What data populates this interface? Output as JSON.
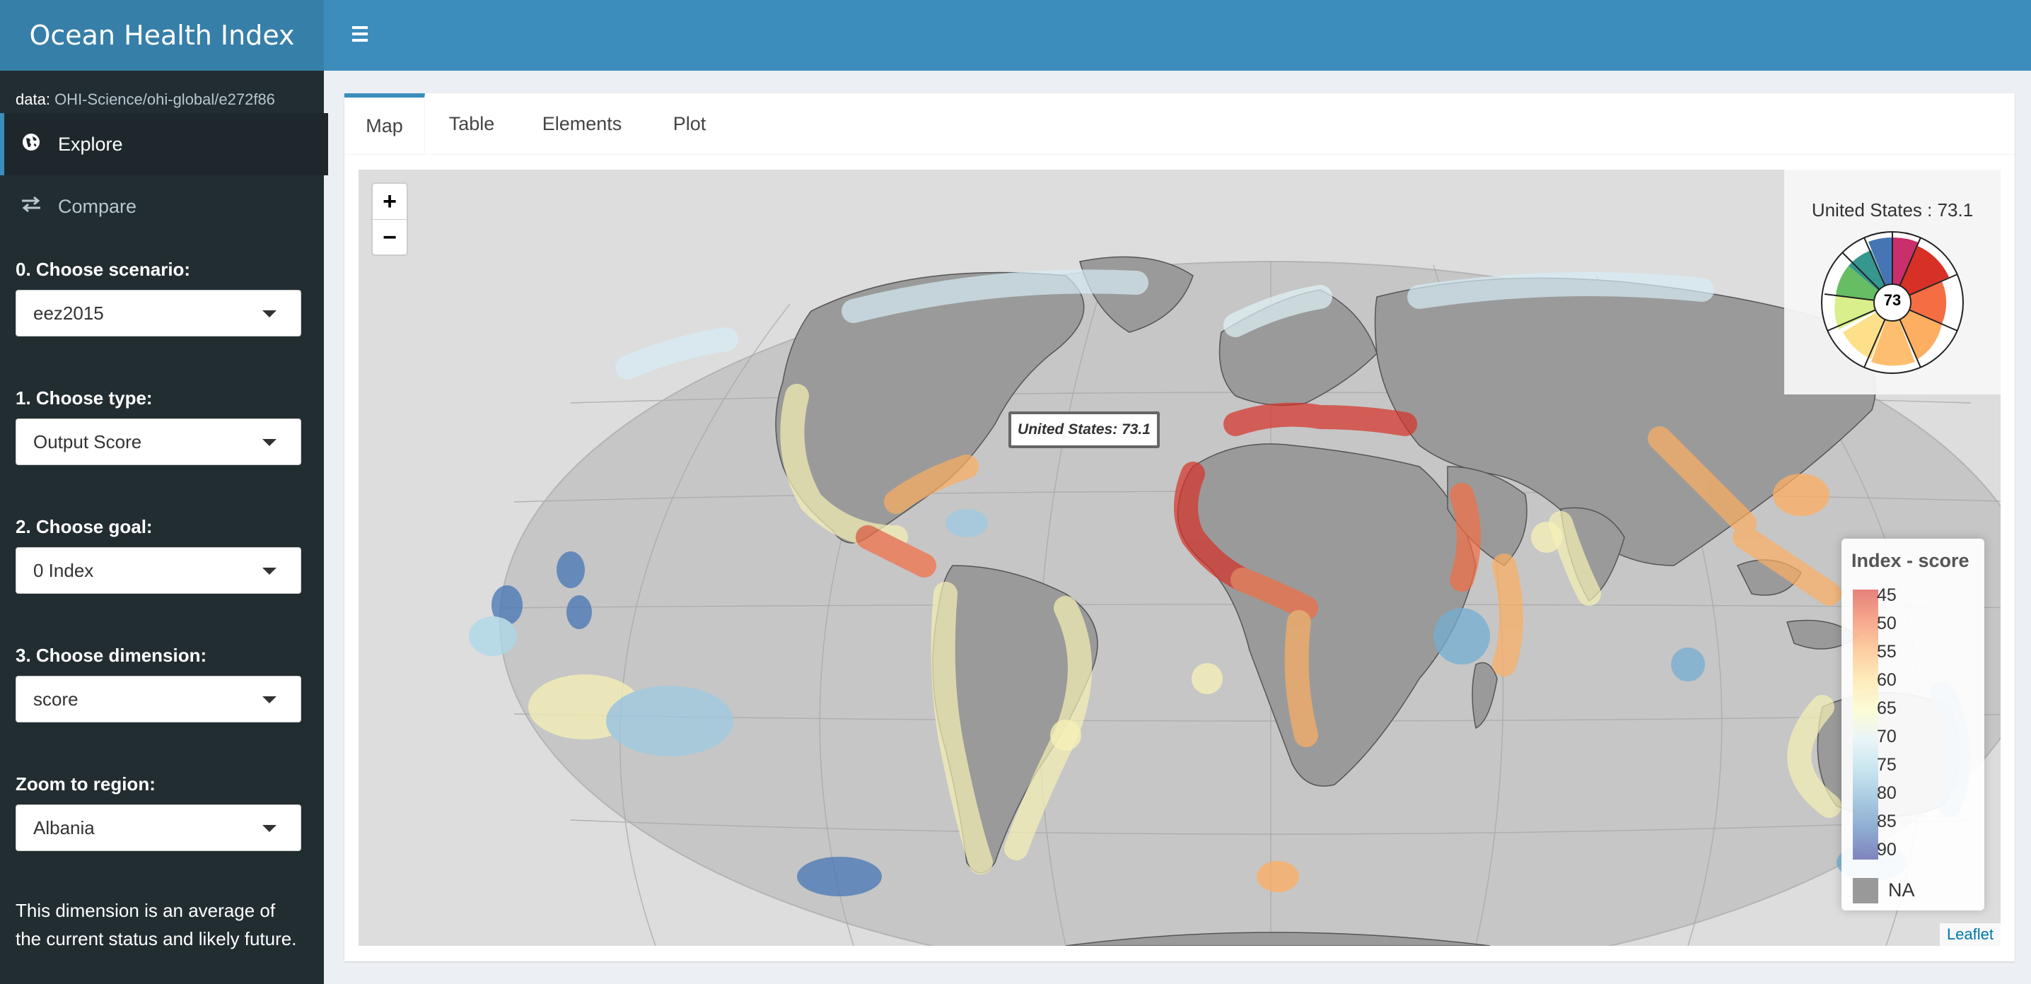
{
  "app": {
    "title": "Ocean Health Index"
  },
  "sidebar": {
    "data_label": "data:",
    "data_source": "OHI-Science/ohi-global/e272f86",
    "menu": [
      {
        "label": "Explore",
        "icon": "globe-icon",
        "active": true
      },
      {
        "label": "Compare",
        "icon": "exchange-icon",
        "active": false
      }
    ],
    "controls": [
      {
        "label": "0. Choose scenario:",
        "value": "eez2015"
      },
      {
        "label": "1. Choose type:",
        "value": "Output Score"
      },
      {
        "label": "2. Choose goal:",
        "value": "0 Index"
      },
      {
        "label": "3. Choose dimension:",
        "value": "score"
      },
      {
        "label": "Zoom to region:",
        "value": "Albania"
      }
    ],
    "note": "This dimension is an average of the current status and likely future."
  },
  "tabs": [
    {
      "label": "Map",
      "active": true
    },
    {
      "label": "Table",
      "active": false
    },
    {
      "label": "Elements",
      "active": false
    },
    {
      "label": "Plot",
      "active": false
    }
  ],
  "map": {
    "zoom_in": "+",
    "zoom_out": "−",
    "hover_tooltip": "United States: 73.1",
    "info_panel_title": "United States : 73.1",
    "flower_score": "73",
    "legend": {
      "title": "Index - score",
      "ticks": [
        "45",
        "50",
        "55",
        "60",
        "65",
        "70",
        "75",
        "80",
        "85",
        "90"
      ],
      "na_label": "NA"
    },
    "attribution": "Leaflet"
  },
  "colors": {
    "header": "#3c8dbc",
    "brand": "#367fa9",
    "sidebar": "#222d32",
    "land": "#999999",
    "ocean": "#c8c8c8"
  }
}
